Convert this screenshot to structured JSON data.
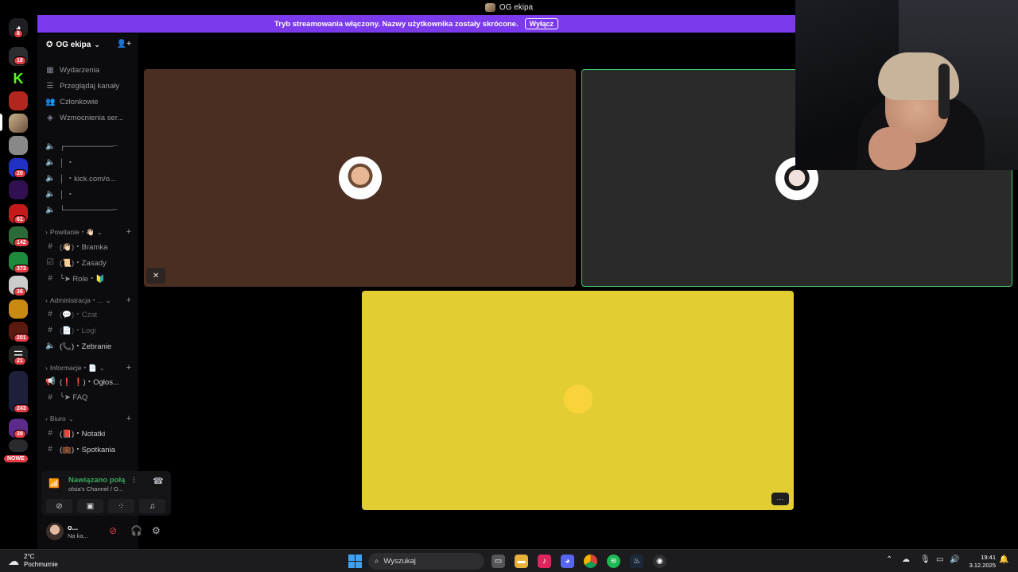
{
  "window": {
    "title": "OG ekipa"
  },
  "banner": {
    "text": "Tryb streamowania włączony. Nazwy użytkownika zostały skrócone.",
    "button": "Wyłącz",
    "color": "#7c3aed"
  },
  "server": {
    "name": "OG ekipa",
    "chevron": "⌄"
  },
  "rail_badges": [
    "8",
    "18",
    "20",
    "61",
    "142",
    "373",
    "36",
    "201",
    "21",
    "243",
    "39"
  ],
  "rail_new": "NOWE",
  "nav_items": [
    "Wydarzenia",
    "Przeglądaj kanały",
    "Członkowie",
    "Wzmocnienia ser..."
  ],
  "voice_channels": [
    "┌─────────┈",
    "│ ・",
    "│ ・kick.com/o...",
    "│ ・",
    "└─────────┈"
  ],
  "categories": {
    "powitanie": "Powitanie・👋🏻",
    "administracja": "Administracja・...",
    "informacje": "Informacje・📄",
    "biuro": "Biuro"
  },
  "channels": {
    "bramka": "(👋🏻)・Bramka",
    "zasady": "(📜)・Zasady",
    "role": "╰➤ Role・🔰",
    "czat": "(💬)・Czat",
    "logi": "(📄)・Logi",
    "zebranie": "(📞)・Zebranie",
    "ogloszenia": "(❗ ❗)・Ogłos...",
    "faq": "╰➤ FAQ",
    "notatki": "(📕)・Notatki",
    "spotkania": "(💼)・Spotkania"
  },
  "voice_panel": {
    "status": "Nawiązano połą",
    "channel": "olsia's Channel / O..."
  },
  "user": {
    "name": "o...",
    "status": "Na ka..."
  },
  "tiles": {
    "colors": [
      "#4a2e22",
      "#2a2a2b",
      "#e2cd33"
    ],
    "speaking_border": "#3dcf6a"
  },
  "more_label": "···",
  "taskbar": {
    "temp": "2°C",
    "weather": "Pochmurnie",
    "search_placeholder": "Wyszukaj",
    "time": "19:41",
    "date": "3.12.2025"
  }
}
